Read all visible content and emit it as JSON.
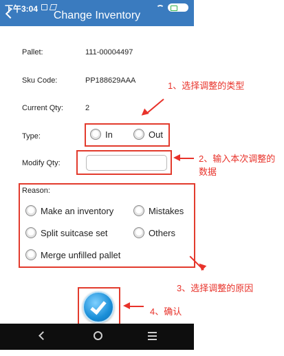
{
  "status_bar": {
    "time": "下午3:04"
  },
  "header": {
    "title": "Change Inventory"
  },
  "details": {
    "pallet": {
      "label": "Pallet:",
      "value": "111-00004497"
    },
    "sku": {
      "label": "Sku Code:",
      "value": "PP188629AAA"
    },
    "current_qty": {
      "label": "Current Qty:",
      "value": "2"
    }
  },
  "type": {
    "label": "Type:",
    "options": [
      "In",
      "Out"
    ]
  },
  "modify_qty": {
    "label": "Modify Qty:",
    "value": ""
  },
  "reason": {
    "label": "Reason:",
    "options": [
      "Make an inventory",
      "Mistakes",
      "Split suitcase set",
      "Others",
      "Merge unfilled pallet"
    ]
  },
  "annotations": {
    "step1": "1、选择调整的类型",
    "step2_line1": "2、输入本次调整的",
    "step2_line2": "数据",
    "step3": "3、选择调整的原因",
    "step4": "4、确认"
  },
  "colors": {
    "header": "#3a7bbf",
    "annotation": "#e8322a",
    "confirm": "#1a8fd8",
    "navbar": "#0e0e0e"
  },
  "icons": {
    "back": "back-arrow-icon",
    "confirm": "checkmark-icon",
    "nav": [
      "nav-back-icon",
      "nav-home-icon",
      "nav-menu-icon"
    ]
  }
}
